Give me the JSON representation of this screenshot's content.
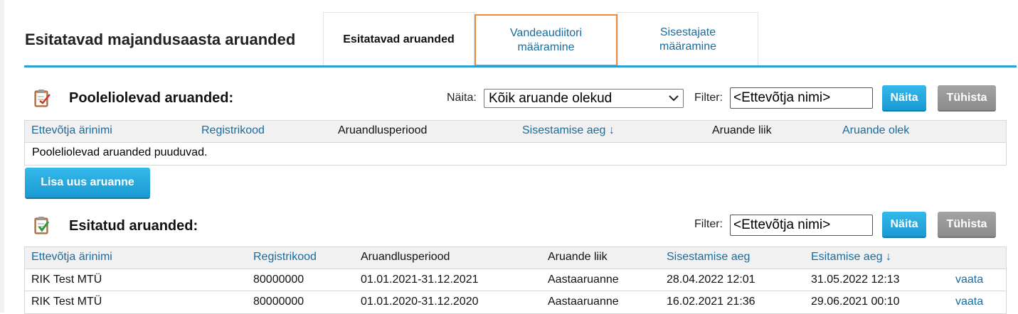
{
  "page_title": "Esitatavad majandusaasta aruanded",
  "tabs": [
    {
      "line1": "Esitatavad aruanded",
      "line2": ""
    },
    {
      "line1": "Vandeaudiitori",
      "line2": "määramine"
    },
    {
      "line1": "Sisestajate",
      "line2": "määramine"
    }
  ],
  "pending": {
    "title": "Pooleliolevad aruanded:",
    "show_label": "Näita:",
    "show_value": "Kõik aruande olekud",
    "filter_label": "Filter:",
    "filter_value": "<Ettevõtja nimi>",
    "show_button": "Näita",
    "clear_button": "Tühista",
    "columns": [
      "Ettevõtja ärinimi",
      "Registrikood",
      "Aruandlusperiood",
      "Sisestamise aeg ↓",
      "Aruande liik",
      "Aruande olek"
    ],
    "empty_text": "Pooleliolevad aruanded puuduvad.",
    "add_button": "Lisa uus aruanne"
  },
  "submitted": {
    "title": "Esitatud aruanded:",
    "filter_label": "Filter:",
    "filter_value": "<Ettevõtja nimi>",
    "show_button": "Näita",
    "clear_button": "Tühista",
    "columns": [
      "Ettevõtja ärinimi",
      "Registrikood",
      "Aruandlusperiood",
      "Aruande liik",
      "Sisestamise aeg",
      "Esitamise aeg ↓"
    ],
    "rows": [
      [
        "RIK Test MTÜ",
        "80000000",
        "01.01.2021-31.12.2021",
        "Aastaaruanne",
        "28.04.2022 12:01",
        "31.05.2022 12:13",
        "vaata"
      ],
      [
        "RIK Test MTÜ",
        "80000000",
        "01.01.2020-31.12.2020",
        "Aastaaruanne",
        "16.02.2021 21:36",
        "29.06.2021 00:10",
        "vaata"
      ]
    ]
  },
  "colors": {
    "accent": "#2ba0d8",
    "link": "#1a6b9e",
    "highlight": "#f08a3c"
  },
  "icons": [
    "clipboard-pending-icon",
    "clipboard-check-icon",
    "chevron-down-icon"
  ]
}
